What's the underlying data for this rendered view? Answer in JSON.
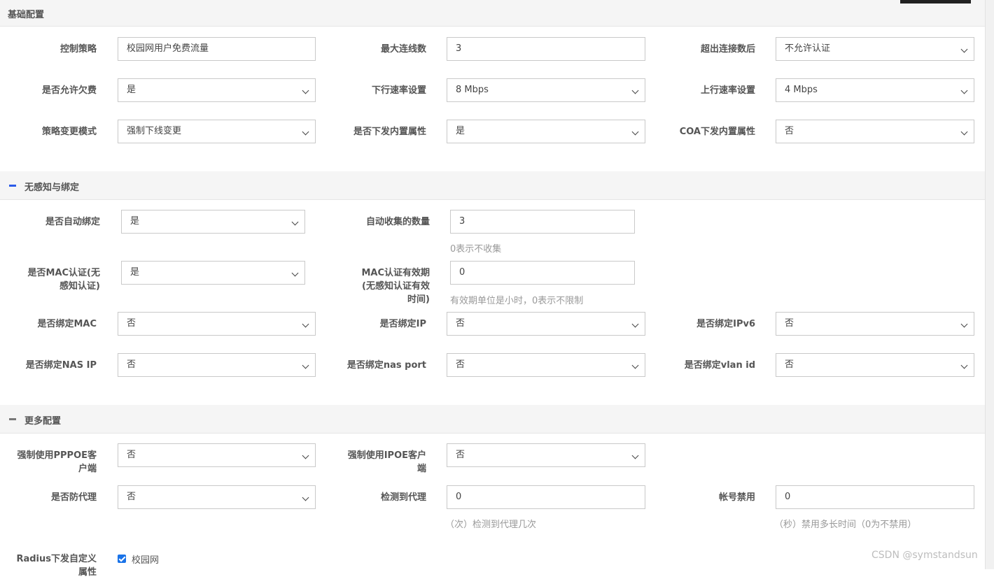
{
  "colors": {
    "accent": "#1a73e8",
    "toggle_blue": "#2b5be8",
    "toggle_gray": "#777777"
  },
  "sections": {
    "basic": "基础配置",
    "binding": "无感知与绑定",
    "more": "更多配置"
  },
  "basic": {
    "control_policy": {
      "label": "控制策略",
      "value": "校园网用户免费流量"
    },
    "max_connections": {
      "label": "最大连线数",
      "value": "3"
    },
    "over_limit": {
      "label": "超出连接数后",
      "value": "不允许认证"
    },
    "allow_arrears": {
      "label": "是否允许欠费",
      "value": "是"
    },
    "down_rate": {
      "label": "下行速率设置",
      "value": "8 Mbps"
    },
    "up_rate": {
      "label": "上行速率设置",
      "value": "4 Mbps"
    },
    "policy_change_mode": {
      "label": "策略变更模式",
      "value": "强制下线变更"
    },
    "send_builtin_attr": {
      "label": "是否下发内置属性",
      "value": "是"
    },
    "coa_builtin_attr": {
      "label": "COA下发内置属性",
      "value": "否"
    }
  },
  "binding": {
    "auto_bind": {
      "label": "是否自动绑定",
      "value": "是"
    },
    "auto_collect_count": {
      "label": "自动收集的数量",
      "value": "3",
      "hint": "0表示不收集"
    },
    "mac_auth": {
      "label_line1": "是否MAC认证(无",
      "label_line2": "感知认证)",
      "value": "是"
    },
    "mac_validity": {
      "label_line1": "MAC认证有效期",
      "label_line2": "(无感知认证有效",
      "label_line3": "时间)",
      "value": "0",
      "hint": "有效期单位是小时，0表示不限制"
    },
    "bind_mac": {
      "label": "是否绑定MAC",
      "value": "否"
    },
    "bind_ip": {
      "label": "是否绑定IP",
      "value": "否"
    },
    "bind_ipv6": {
      "label": "是否绑定IPv6",
      "value": "否"
    },
    "bind_nas_ip": {
      "label": "是否绑定NAS IP",
      "value": "否"
    },
    "bind_nas_port": {
      "label": "是否绑定nas port",
      "value": "否"
    },
    "bind_vlan_id": {
      "label": "是否绑定vlan id",
      "value": "否"
    }
  },
  "more": {
    "force_pppoe": {
      "label_line1": "强制使用PPPOE客",
      "label_line2": "户端",
      "value": "否"
    },
    "force_ipoe": {
      "label_line1": "强制使用IPOE客户",
      "label_line2": "端",
      "value": "否"
    },
    "anti_proxy": {
      "label": "是否防代理",
      "value": "否"
    },
    "proxy_detect": {
      "label": "检测到代理",
      "value": "0",
      "hint": "（次）检测到代理几次"
    },
    "account_disable": {
      "label": "帐号禁用",
      "value": "0",
      "hint": "（秒）禁用多长时间（0为不禁用）"
    },
    "radius_custom": {
      "label_line1": "Radius下发自定义",
      "label_line2": "属性",
      "checkbox_label": "校园网",
      "checked": true
    }
  },
  "watermark": "CSDN @symstandsun"
}
